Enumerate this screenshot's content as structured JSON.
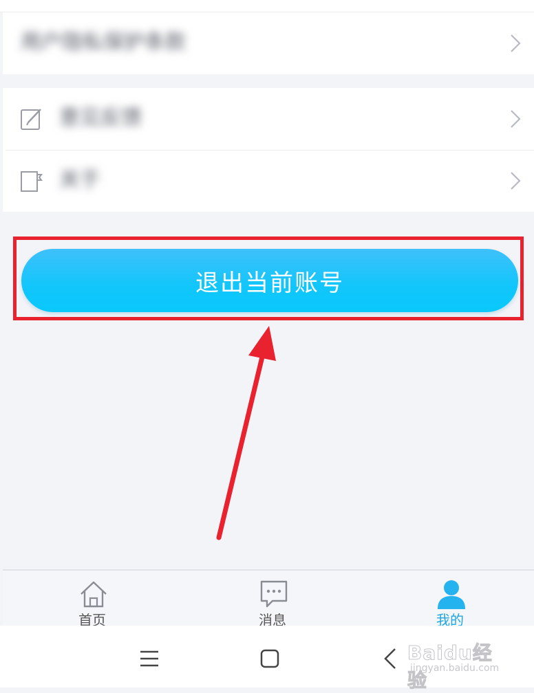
{
  "settings": {
    "items": [
      {
        "label": "用户隐私保护条款",
        "icon": "none",
        "chevron": "chevron-right-icon"
      },
      {
        "label": "意见反馈",
        "icon": "edit-note-icon",
        "chevron": "chevron-right-icon"
      },
      {
        "label": "关于",
        "icon": "about-doc-icon",
        "chevron": "chevron-right-icon"
      }
    ]
  },
  "logout": {
    "label": "退出当前账号",
    "highlight_color": "#e8222f",
    "button_color": "#11c6fb"
  },
  "tabbar": {
    "tabs": [
      {
        "label": "首页",
        "icon": "home-icon",
        "active": false
      },
      {
        "label": "消息",
        "icon": "message-icon",
        "active": false
      },
      {
        "label": "我的",
        "icon": "user-icon",
        "active": true
      }
    ],
    "active_color": "#1fa6e4"
  },
  "system_nav": {
    "buttons": [
      "menu-icon",
      "home-square-icon",
      "back-chevron-icon"
    ]
  },
  "watermark": {
    "main": "Baidu经验",
    "sub": "jingyan.baidu.com"
  }
}
